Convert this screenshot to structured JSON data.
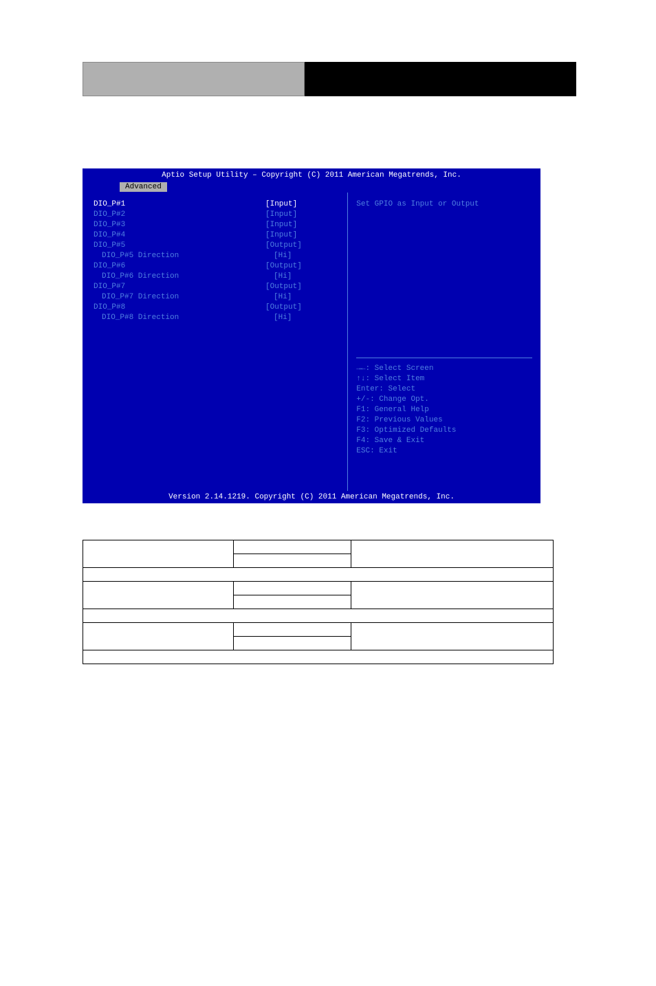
{
  "bios": {
    "title": "Aptio Setup Utility – Copyright (C) 2011 American Megatrends, Inc.",
    "tab": "Advanced",
    "footer": "Version 2.14.1219. Copyright (C) 2011 American Megatrends, Inc.",
    "rows": [
      {
        "label": "DIO_P#1",
        "value": "[Input]",
        "selected": true
      },
      {
        "label": "DIO_P#2",
        "value": "[Input]"
      },
      {
        "label": "DIO_P#3",
        "value": "[Input]"
      },
      {
        "label": "DIO_P#4",
        "value": "[Input]"
      },
      {
        "label": "DIO_P#5",
        "value": "[Output]"
      },
      {
        "label": "DIO_P#5 Direction",
        "value": "[Hi]",
        "indent": true
      },
      {
        "label": "DIO_P#6",
        "value": "[Output]"
      },
      {
        "label": "DIO_P#6 Direction",
        "value": "[Hi]",
        "indent": true
      },
      {
        "label": "DIO_P#7",
        "value": "[Output]"
      },
      {
        "label": "DIO_P#7 Direction",
        "value": "[Hi]",
        "indent": true
      },
      {
        "label": "DIO_P#8",
        "value": "[Output]"
      },
      {
        "label": "DIO_P#8 Direction",
        "value": "[Hi]",
        "indent": true
      }
    ],
    "help_top": "Set GPIO as Input or Output",
    "help_keys": [
      "→←: Select Screen",
      "↑↓: Select Item",
      "Enter: Select",
      "+/-: Change Opt.",
      "F1: General Help",
      "F2: Previous Values",
      "F3: Optimized Defaults",
      "F4: Save & Exit",
      "ESC: Exit"
    ]
  }
}
